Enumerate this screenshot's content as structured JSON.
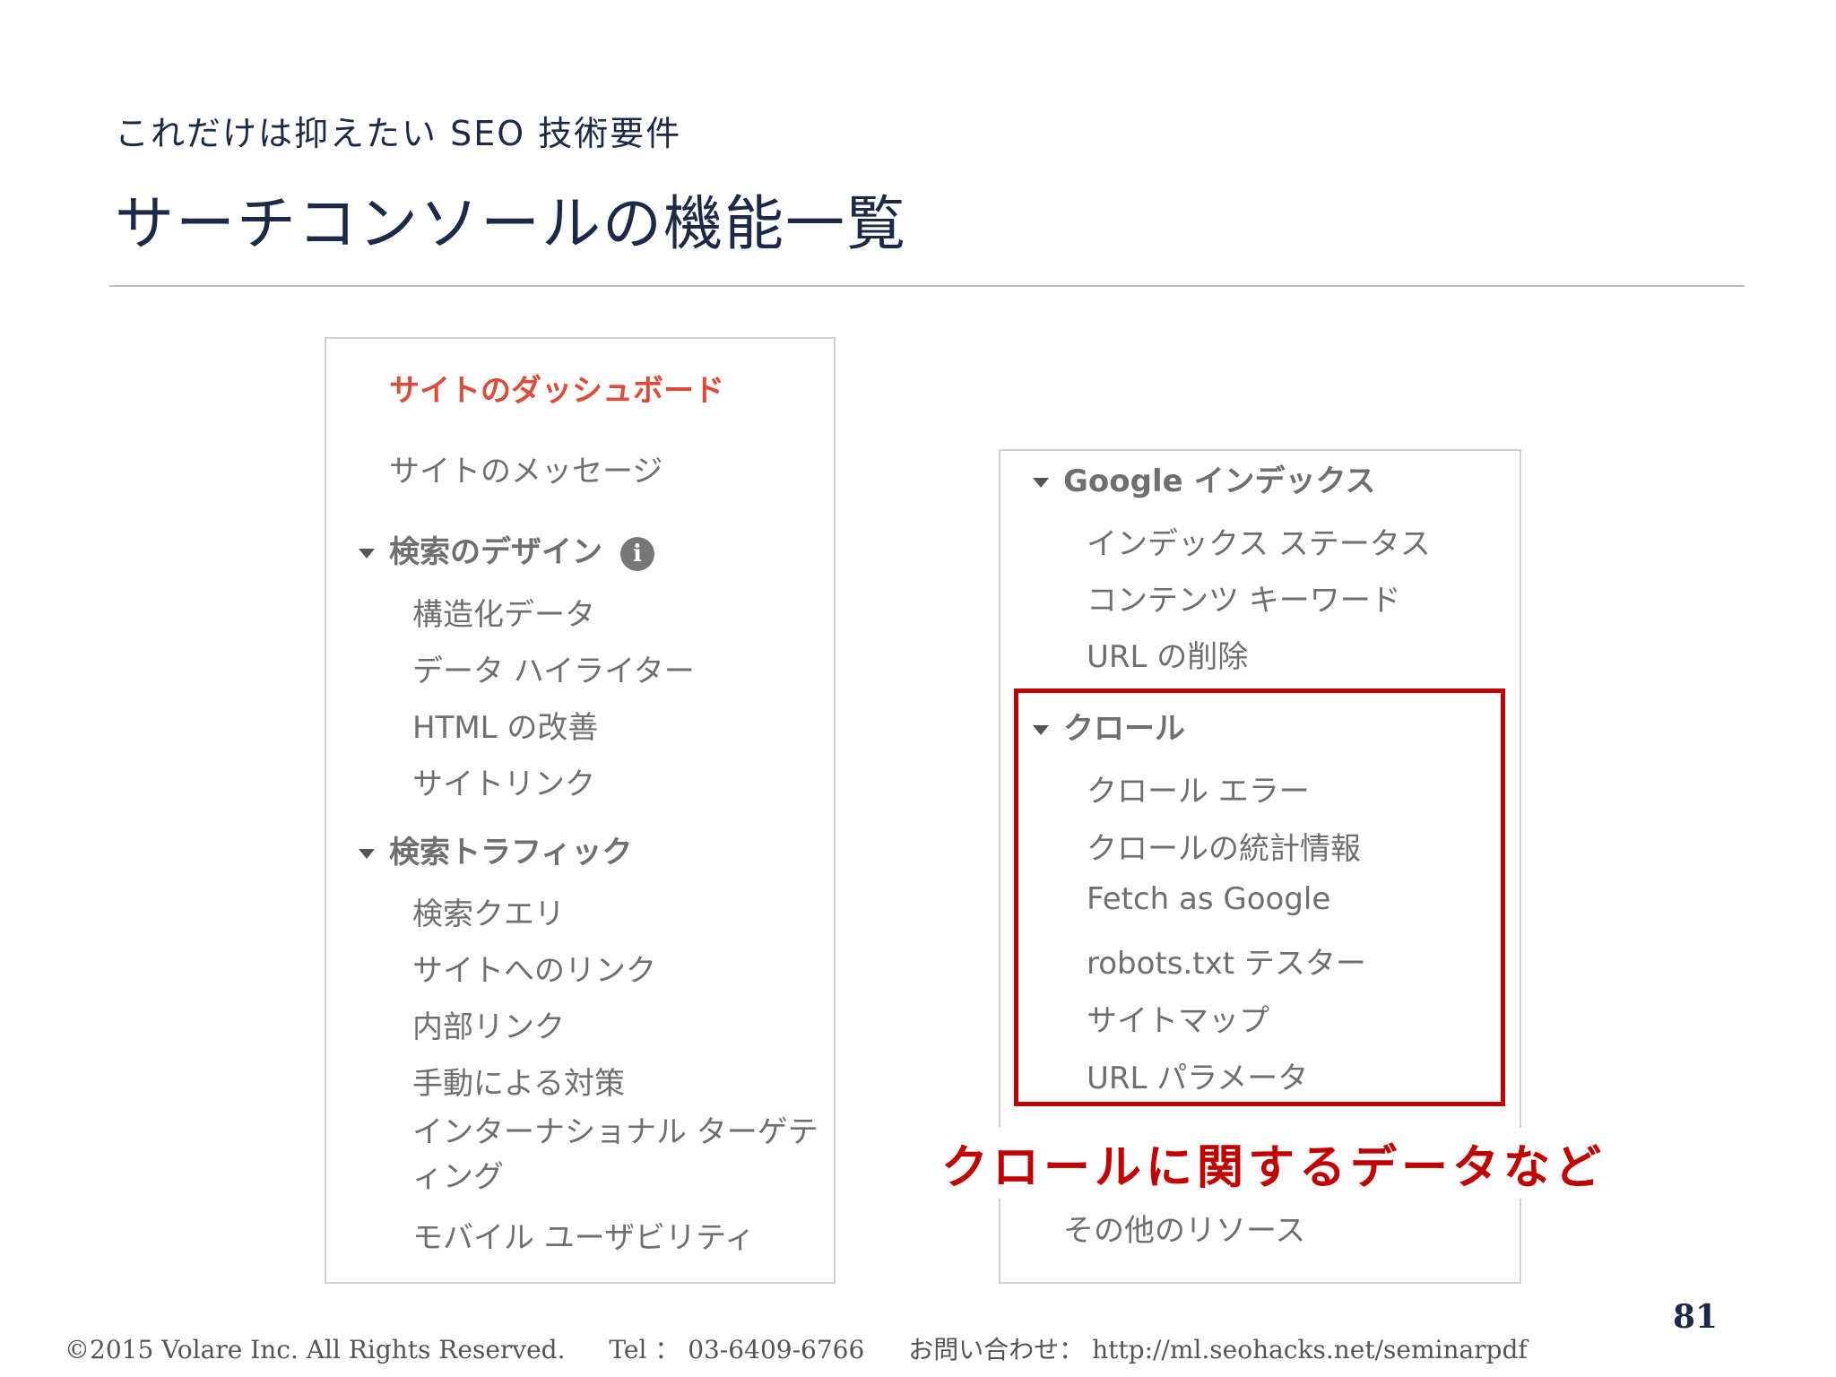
{
  "header": {
    "subtitle": "これだけは抑えたい SEO 技術要件",
    "title": "サーチコンソールの機能一覧"
  },
  "left_panel": {
    "active_item": "サイトのダッシュボード",
    "messages": "サイトのメッセージ",
    "search_appearance": {
      "label": "検索のデザイン",
      "info_glyph": "i",
      "items": [
        "構造化データ",
        "データ ハイライター",
        "HTML の改善",
        "サイトリンク"
      ]
    },
    "search_traffic": {
      "label": "検索トラフィック",
      "items": [
        "検索クエリ",
        "サイトへのリンク",
        "内部リンク",
        "手動による対策",
        "インターナショナル ターゲティング",
        "モバイル ユーザビリティ"
      ]
    }
  },
  "right_panel": {
    "google_index": {
      "label": "Google インデックス",
      "items": [
        "インデックス ステータス",
        "コンテンツ キーワード",
        "URL の削除"
      ]
    },
    "crawl": {
      "label": "クロール",
      "items": [
        "クロール エラー",
        "クロールの統計情報",
        "Fetch as Google",
        "robots.txt テスター",
        "サイトマップ",
        "URL パラメータ"
      ]
    },
    "other_resources": "その他のリソース"
  },
  "callout": "クロールに関するデータなど",
  "page_number": "81",
  "footer": {
    "copyright": "©2015 Volare Inc. All Rights Reserved.",
    "tel": "Tel ： 03-6409-6766",
    "contact": "お問い合わせ： http://ml.seohacks.net/seminarpdf"
  },
  "colors": {
    "title": "#1b2a47",
    "active_item": "#dd4b39",
    "highlight": "#c00000",
    "menu_text": "#6f6f6f"
  }
}
